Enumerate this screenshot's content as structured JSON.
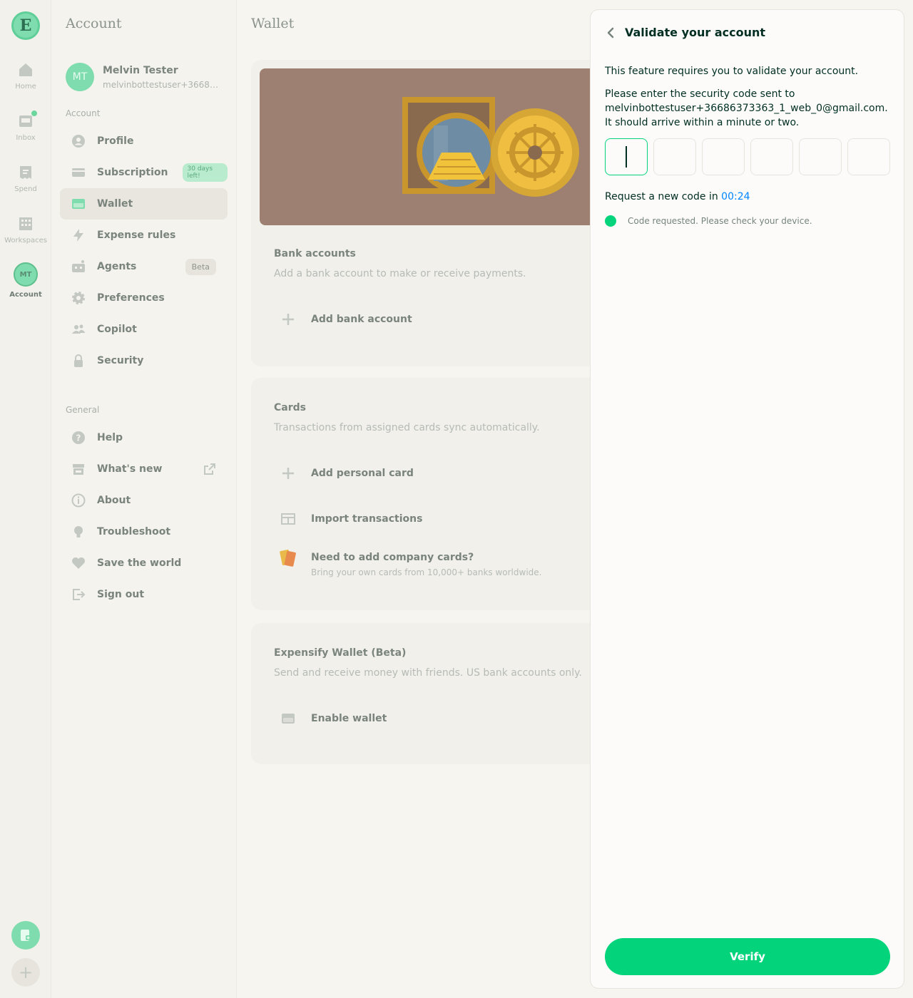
{
  "rail": {
    "logo": "E",
    "items": [
      {
        "label": "Home",
        "icon": "home-icon"
      },
      {
        "label": "Inbox",
        "icon": "inbox-icon"
      },
      {
        "label": "Spend",
        "icon": "receipt-icon"
      },
      {
        "label": "Workspaces",
        "icon": "building-icon"
      },
      {
        "label": "Account",
        "icon": "avatar"
      }
    ],
    "account_initials": "MT"
  },
  "sidebar": {
    "title": "Account",
    "user": {
      "initials": "MT",
      "name": "Melvin Tester",
      "email": "melvinbottestuser+366863..."
    },
    "account_label": "Account",
    "account_items": [
      {
        "label": "Profile",
        "icon": "profile-icon"
      },
      {
        "label": "Subscription",
        "icon": "credit-card-icon",
        "badge": "30 days left!"
      },
      {
        "label": "Wallet",
        "icon": "wallet-icon",
        "active": true
      },
      {
        "label": "Expense rules",
        "icon": "lightning-icon"
      },
      {
        "label": "Agents",
        "icon": "robot-icon",
        "badge": "Beta"
      },
      {
        "label": "Preferences",
        "icon": "gear-icon"
      },
      {
        "label": "Copilot",
        "icon": "users-icon"
      },
      {
        "label": "Security",
        "icon": "lock-icon"
      }
    ],
    "general_label": "General",
    "general_items": [
      {
        "label": "Help",
        "icon": "question-icon"
      },
      {
        "label": "What's new",
        "icon": "gift-icon"
      },
      {
        "label": "About",
        "icon": "info-icon"
      },
      {
        "label": "Troubleshoot",
        "icon": "lightbulb-icon"
      },
      {
        "label": "Save the world",
        "icon": "heart-icon"
      },
      {
        "label": "Sign out",
        "icon": "sign-out-icon"
      }
    ]
  },
  "main": {
    "title": "Wallet",
    "bank": {
      "heading": "Bank accounts",
      "subtitle": "Add a bank account to make or receive payments.",
      "add_label": "Add bank account"
    },
    "cards": {
      "heading": "Cards",
      "subtitle": "Transactions from assigned cards sync automatically.",
      "add_personal": "Add personal card",
      "import": "Import transactions",
      "company_heading": "Need to add company cards?",
      "company_sub": "Bring your own cards from 10,000+ banks worldwide."
    },
    "wallet": {
      "heading": "Expensify Wallet (Beta)",
      "subtitle": "Send and receive money with friends. US bank accounts only.",
      "enable": "Enable wallet"
    }
  },
  "panel": {
    "title": "Validate your account",
    "intro": "This feature requires you to validate your account.",
    "instructions": "Please enter the security code sent to melvinbottestuser+36686373363_1_web_0@gmail.com. It should arrive within a minute or two.",
    "request_prefix": "Request a new code in ",
    "timer": "00:24",
    "status": "Code requested. Please check your device.",
    "code_digits": [
      "",
      "",
      "",
      "",
      "",
      ""
    ],
    "verify_label": "Verify"
  },
  "colors": {
    "accent": "#03d47c",
    "link": "#0185ff",
    "text_dark": "#002e22"
  }
}
